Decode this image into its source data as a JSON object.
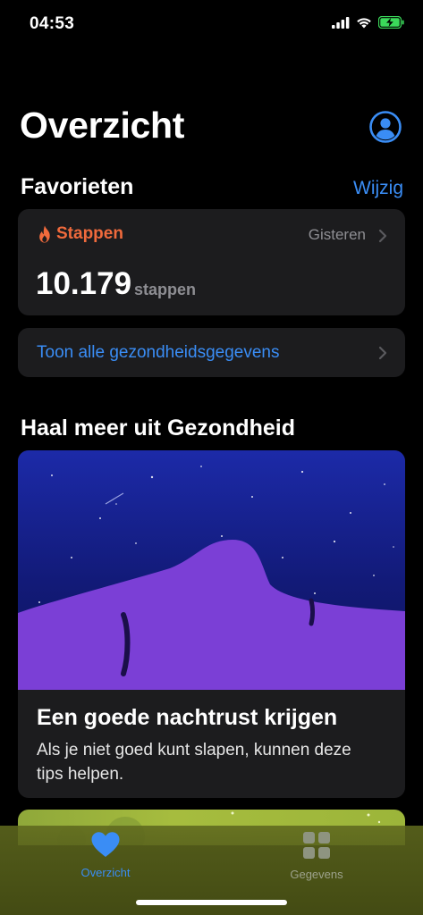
{
  "status_bar": {
    "time": "04:53"
  },
  "header": {
    "title": "Overzicht"
  },
  "favorites": {
    "heading": "Favorieten",
    "edit_label": "Wijzig",
    "card": {
      "title": "Stappen",
      "date": "Gisteren",
      "value": "10.179",
      "unit": "stappen",
      "accent": "#f06a3c"
    },
    "show_all_label": "Toon alle gezondheidsgegevens"
  },
  "more": {
    "heading": "Haal meer uit Gezondheid",
    "article": {
      "title": "Een goede nachtrust krijgen",
      "subtitle": "Als je niet goed kunt slapen, kunnen deze tips helpen."
    }
  },
  "tab_bar": {
    "items": [
      {
        "label": "Overzicht",
        "icon": "heart-icon",
        "active": true,
        "color": "#3a8df5"
      },
      {
        "label": "Gegevens",
        "icon": "grid-icon",
        "active": false,
        "color": "#8e9480"
      }
    ]
  },
  "colors": {
    "link": "#3a8df5",
    "card": "#1c1c1e",
    "secondary_text": "#8e8e93"
  }
}
